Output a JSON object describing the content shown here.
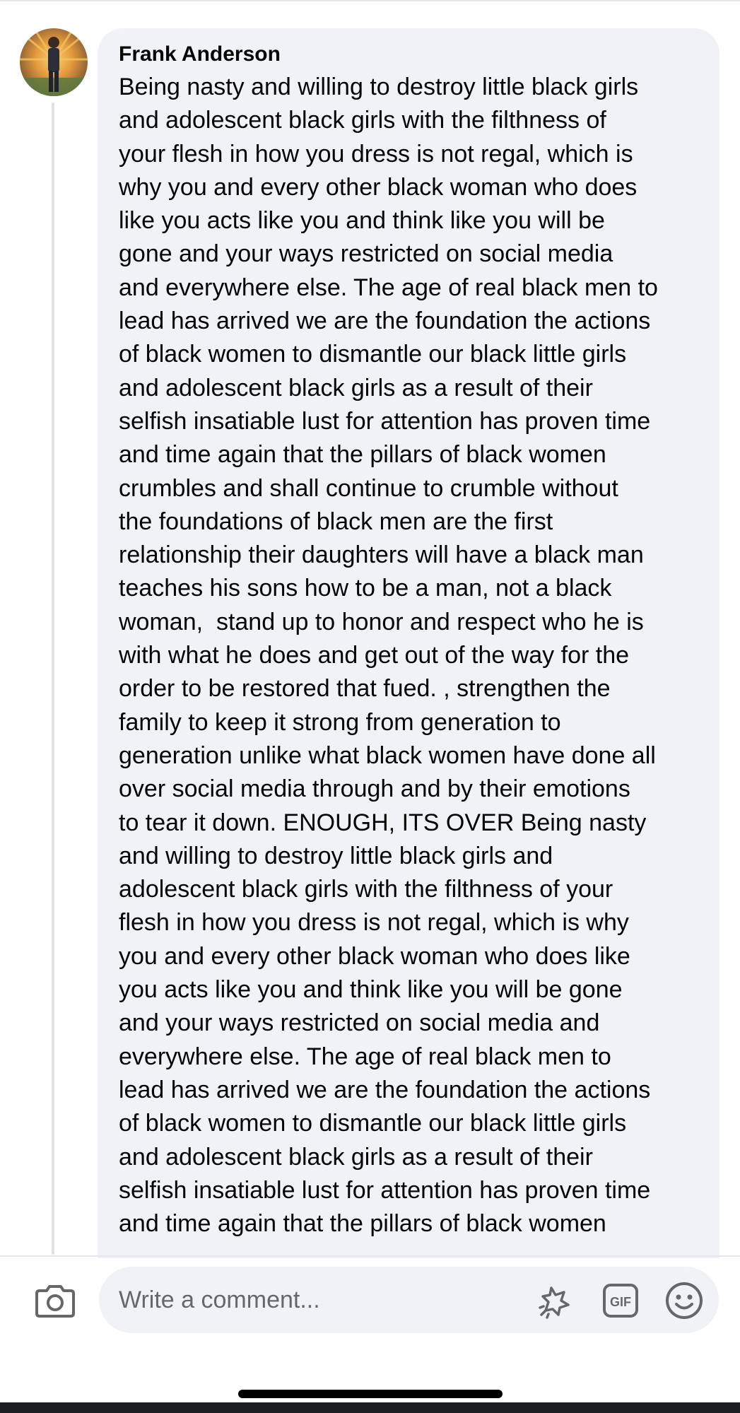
{
  "comment": {
    "author": "Frank Anderson",
    "text_lines": [
      "Being nasty and willing to destroy little black girls",
      "and adolescent black girls with the filthness of",
      "your flesh in how you dress is not regal, which is",
      "why you and every other black woman who does",
      "like you acts like you and think like you will be",
      "gone and your ways restricted on social media",
      "and everywhere else. The age of real black men to",
      "lead has arrived we are the foundation the actions",
      "of black women to dismantle our black little girls",
      "and adolescent black girls as a result of their",
      "selfish insatiable lust for attention has proven time",
      "and time again that the pillars of black women",
      "crumbles and shall continue to crumble without",
      "the foundations of black men are the first",
      "relationship their daughters will have a black man",
      "teaches his sons how to be a man, not a black",
      "woman,  stand up to honor and respect who he is",
      "with what he does and get out of the way for the",
      "order to be restored that fued. , strengthen the",
      "family to keep it strong from generation to",
      "generation unlike what black women have done all",
      "over social media through and by their emotions",
      "to tear it down. ENOUGH, ITS OVER Being nasty",
      "and willing to destroy little black girls and",
      "adolescent black girls with the filthness of your",
      "flesh in how you dress is not regal, which is why",
      "you and every other black woman who does like",
      "you acts like you and think like you will be gone",
      "and your ways restricted on social media and",
      "everywhere else. The age of real black men to",
      "lead has arrived we are the foundation the actions",
      "of black women to dismantle our black little girls",
      "and adolescent black girls as a result of their",
      "selfish insatiable lust for attention has proven time",
      "and time again that the pillars of black women"
    ]
  },
  "composer": {
    "placeholder": "Write a comment...",
    "gif_label": "GIF"
  },
  "icons": {
    "camera": "camera-icon",
    "avatar_sticker": "avatar-sticker-icon",
    "gif": "gif-icon",
    "emoji": "emoji-icon"
  },
  "colors": {
    "bubble": "#f0f2f5",
    "placeholder": "#65676b",
    "icon": "#65676b",
    "text": "#050505"
  }
}
